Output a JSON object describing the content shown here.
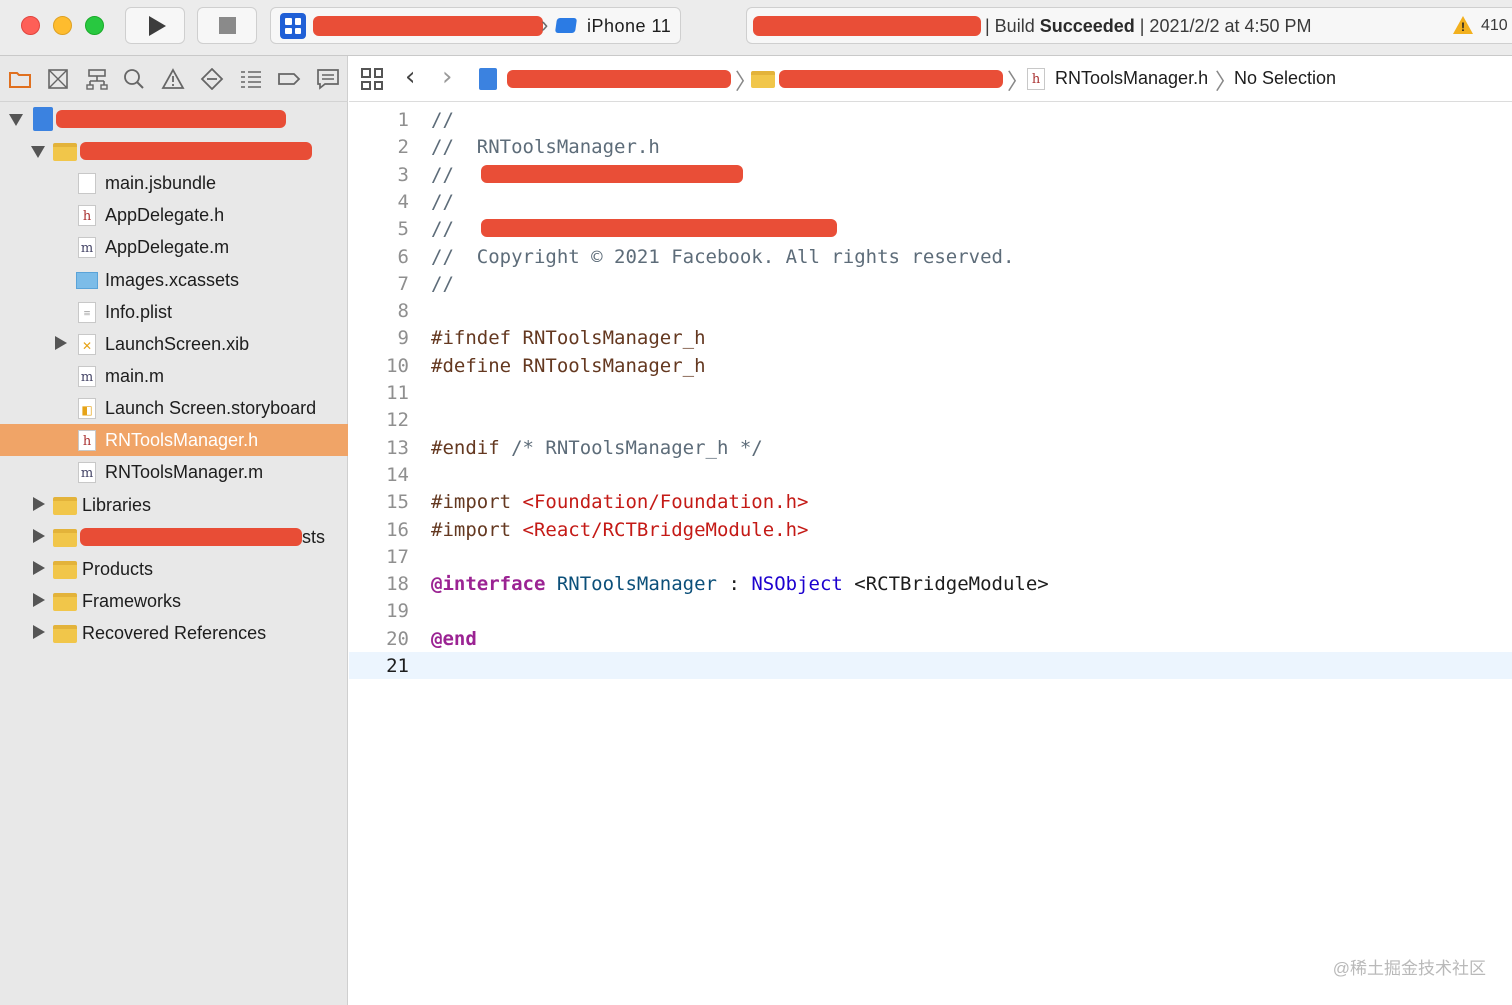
{
  "titlebar": {
    "device": "iPhone 11",
    "activity": {
      "prefix": "| Build ",
      "status": "Succeeded",
      "suffix": " | 2021/2/2 at 4:50 PM"
    },
    "warning_count": "410"
  },
  "navigator": {
    "tabs": [
      "folder-icon",
      "source-control-icon",
      "symbol-icon",
      "find-icon",
      "issue-icon",
      "test-icon",
      "debug-icon",
      "breakpoint-icon",
      "report-icon"
    ],
    "items": [
      {
        "label": "",
        "kind": "project",
        "indent": 0,
        "open": true
      },
      {
        "label": "",
        "kind": "folder",
        "indent": 1,
        "open": true
      },
      {
        "label": "main.jsbundle",
        "kind": "jsbundle",
        "indent": 2
      },
      {
        "label": "AppDelegate.h",
        "kind": "h",
        "indent": 2
      },
      {
        "label": "AppDelegate.m",
        "kind": "m",
        "indent": 2
      },
      {
        "label": "Images.xcassets",
        "kind": "xcassets",
        "indent": 2
      },
      {
        "label": "Info.plist",
        "kind": "plist",
        "indent": 2
      },
      {
        "label": "LaunchScreen.xib",
        "kind": "xib",
        "indent": 2,
        "open": false
      },
      {
        "label": "main.m",
        "kind": "m",
        "indent": 2
      },
      {
        "label": "Launch Screen.storyboard",
        "kind": "storyboard",
        "indent": 2
      },
      {
        "label": "RNToolsManager.h",
        "kind": "h",
        "indent": 2,
        "selected": true
      },
      {
        "label": "RNToolsManager.m",
        "kind": "m",
        "indent": 2
      },
      {
        "label": "Libraries",
        "kind": "folder",
        "indent": 1,
        "open": false
      },
      {
        "label": "sts",
        "kind": "folder",
        "indent": 1,
        "open": false
      },
      {
        "label": "Products",
        "kind": "folder",
        "indent": 1,
        "open": false
      },
      {
        "label": "Frameworks",
        "kind": "folder",
        "indent": 1,
        "open": false
      },
      {
        "label": "Recovered References",
        "kind": "folder",
        "indent": 1,
        "open": false
      }
    ]
  },
  "jumpbar": {
    "file": "RNToolsManager.h",
    "selection": "No Selection"
  },
  "editor": {
    "current_line": 21,
    "lines": [
      {
        "n": "1",
        "tokens": [
          {
            "t": "//",
            "c": "comment"
          }
        ]
      },
      {
        "n": "2",
        "tokens": [
          {
            "t": "//  RNToolsManager.h",
            "c": "comment"
          }
        ]
      },
      {
        "n": "3",
        "tokens": [
          {
            "t": "//",
            "c": "comment"
          }
        ]
      },
      {
        "n": "4",
        "tokens": [
          {
            "t": "//",
            "c": "comment"
          }
        ]
      },
      {
        "n": "5",
        "tokens": [
          {
            "t": "//",
            "c": "comment"
          }
        ]
      },
      {
        "n": "6",
        "tokens": [
          {
            "t": "//  Copyright © 2021 Facebook. All rights reserved.",
            "c": "comment"
          }
        ]
      },
      {
        "n": "7",
        "tokens": [
          {
            "t": "//",
            "c": "comment"
          }
        ]
      },
      {
        "n": "8",
        "tokens": []
      },
      {
        "n": "9",
        "tokens": [
          {
            "t": "#ifndef RNToolsManager_h",
            "c": "pre"
          }
        ]
      },
      {
        "n": "10",
        "tokens": [
          {
            "t": "#define RNToolsManager_h",
            "c": "pre"
          }
        ]
      },
      {
        "n": "11",
        "tokens": []
      },
      {
        "n": "12",
        "tokens": []
      },
      {
        "n": "13",
        "tokens": [
          {
            "t": "#endif ",
            "c": "pre"
          },
          {
            "t": "/* RNToolsManager_h */",
            "c": "comment"
          }
        ]
      },
      {
        "n": "14",
        "tokens": []
      },
      {
        "n": "15",
        "tokens": [
          {
            "t": "#import ",
            "c": "pre"
          },
          {
            "t": "<Foundation/Foundation.h>",
            "c": "str"
          }
        ]
      },
      {
        "n": "16",
        "tokens": [
          {
            "t": "#import ",
            "c": "pre"
          },
          {
            "t": "<React/RCTBridgeModule.h>",
            "c": "str"
          }
        ]
      },
      {
        "n": "17",
        "tokens": []
      },
      {
        "n": "18",
        "tokens": [
          {
            "t": "@interface",
            "c": "kw"
          },
          {
            "t": " ",
            "c": "plain"
          },
          {
            "t": "RNToolsManager",
            "c": "type"
          },
          {
            "t": " : ",
            "c": "plain"
          },
          {
            "t": "NSObject",
            "c": "cls"
          },
          {
            "t": " <RCTBridgeModule>",
            "c": "plain"
          }
        ]
      },
      {
        "n": "19",
        "tokens": []
      },
      {
        "n": "20",
        "tokens": [
          {
            "t": "@end",
            "c": "kw"
          }
        ]
      },
      {
        "n": "21",
        "tokens": []
      }
    ]
  },
  "watermark": "@稀土掘金技术社区",
  "colors": {
    "selection": "#f0a467",
    "current_line": "#ecf5fe",
    "redaction": "#e8452c"
  }
}
